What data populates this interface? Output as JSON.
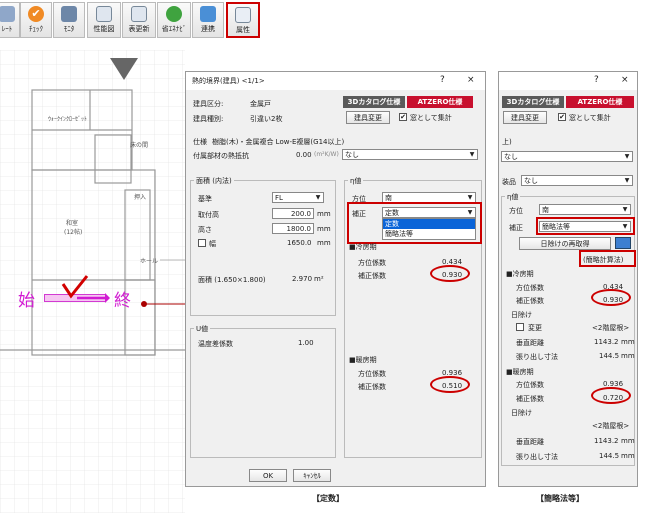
{
  "toolbar": {
    "items": [
      "ﾚｰﾄ",
      "ﾁｪｯｸ",
      "ﾓﾆﾀ",
      "性能図",
      "表更新",
      "省ｴﾈﾅﾋﾞ",
      "連携",
      "属性"
    ]
  },
  "plan": {
    "room1": "ｳｫｰｸｲﾝｸﾛｰｾﾞｯﾄ",
    "room2": "床の間",
    "room3": "押入",
    "room4": "和室",
    "room4_size": "(12帖)",
    "room5": "ホール",
    "start": "始",
    "end": "終"
  },
  "left_dialog": {
    "title": "熱的境界(建具) <1/1>",
    "help": "?",
    "close": "×",
    "type_label": "建具区分:",
    "type_value": "金属戸",
    "kind_label": "建具種別:",
    "kind_value": "引違い2枚",
    "tab_3d": "3Dカタログ仕様",
    "tab_atzero": "ATZERO仕様",
    "change_btn": "建具変更",
    "window_check": "窓として集計",
    "spec_label": "仕様",
    "spec_value": "樹脂(木)・金属複合 Low-E複層(G14以上)",
    "attach_label": "付属部材の熱抵抗",
    "attach_value": "0.00",
    "attach_unit": "(m²K/W)",
    "attach_select": "なし",
    "area_group": "面積 (内法)",
    "base_label": "基準",
    "base_value": "FL",
    "mount_label": "取付高",
    "mount_value": "200.0",
    "height_label": "高さ",
    "height_value": "1800.0",
    "width_label": "幅",
    "width_value": "1650.0",
    "unit_mm": "mm",
    "area_label": "面積 (1.650×1.800)",
    "area_value": "2.970",
    "area_unit": "m²",
    "u_group": "U値",
    "temp_label": "温度差係数",
    "temp_value": "1.00",
    "eta_group": "η値",
    "dir_label": "方位",
    "dir_value": "南",
    "corr_label": "補正",
    "corr_value": "定数",
    "dropdown_options": [
      "定数",
      "簡略法等"
    ],
    "cool_label": "■冷房期",
    "dir_coef_label": "方位係数",
    "cool_dir_coef": "0.434",
    "corr_coef_label": "補正係数",
    "cool_corr_coef": "0.930",
    "heat_label": "■暖房期",
    "heat_dir_coef": "0.936",
    "heat_corr_coef": "0.510",
    "ok": "OK",
    "cancel": "ｷｬﾝｾﾙ",
    "caption": "【定数】"
  },
  "right_dialog": {
    "help": "?",
    "close": "×",
    "tab_3d": "3Dカタログ仕様",
    "tab_atzero": "ATZERO仕様",
    "change_btn": "建具変更",
    "window_check": "窓として集計",
    "spec_partial": "上)",
    "select1": "なし",
    "select2_prefix": "装品",
    "select2": "なし",
    "eta_group": "η値",
    "dir_label": "方位",
    "dir_value": "南",
    "corr_label": "補正",
    "corr_value": "簡略法等",
    "reacquire_btn": "日除けの再取得",
    "method_label": "(簡略計算法)",
    "cool_label": "■冷房期",
    "dir_coef_label": "方位係数",
    "cool_dir_coef": "0.434",
    "corr_coef_label": "補正係数",
    "cool_corr_coef": "0.930",
    "shade_label": "日除け",
    "change_check": "変更",
    "floor_tag": "<2階屋根>",
    "vert_label": "垂直距離",
    "cool_vert": "1143.2",
    "over_label": "張り出し寸法",
    "cool_over": "144.5",
    "unit_mm": "mm",
    "heat_label": "■暖房期",
    "heat_dir_coef": "0.936",
    "heat_corr_coef": "0.720",
    "heat_vert": "1143.2",
    "heat_over": "144.5",
    "caption": "【簡略法等】"
  }
}
